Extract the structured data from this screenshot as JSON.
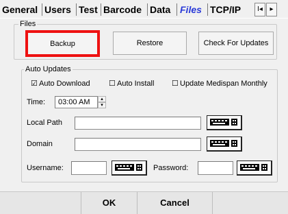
{
  "tabs": [
    {
      "label": "General",
      "active": false
    },
    {
      "label": "Users",
      "active": false
    },
    {
      "label": "Test",
      "active": false
    },
    {
      "label": "Barcode",
      "active": false
    },
    {
      "label": "Data",
      "active": false
    },
    {
      "label": "Files",
      "active": true
    },
    {
      "label": "TCP/IP",
      "active": false
    }
  ],
  "tab_scroll": {
    "prev_icon": "I◂",
    "next_icon": "▸"
  },
  "files_group": {
    "legend": "Files",
    "backup_label": "Backup",
    "restore_label": "Restore",
    "check_updates_label": "Check For Updates"
  },
  "auto_updates": {
    "legend": "Auto Updates",
    "auto_download": {
      "label": "Auto Download",
      "checked": true
    },
    "auto_install": {
      "label": "Auto Install",
      "checked": false
    },
    "update_medispan": {
      "label": "Update Medispan Monthly",
      "checked": false
    },
    "time_label": "Time:",
    "time_value": "03:00 AM",
    "local_path_label": "Local Path",
    "local_path_value": "",
    "domain_label": "Domain",
    "domain_value": "",
    "username_label": "Username:",
    "username_value": "",
    "password_label": "Password:",
    "password_value": ""
  },
  "footer": {
    "ok_label": "OK",
    "cancel_label": "Cancel"
  },
  "colors": {
    "active_tab": "#2a3ad8",
    "highlight": "#ee1111"
  }
}
